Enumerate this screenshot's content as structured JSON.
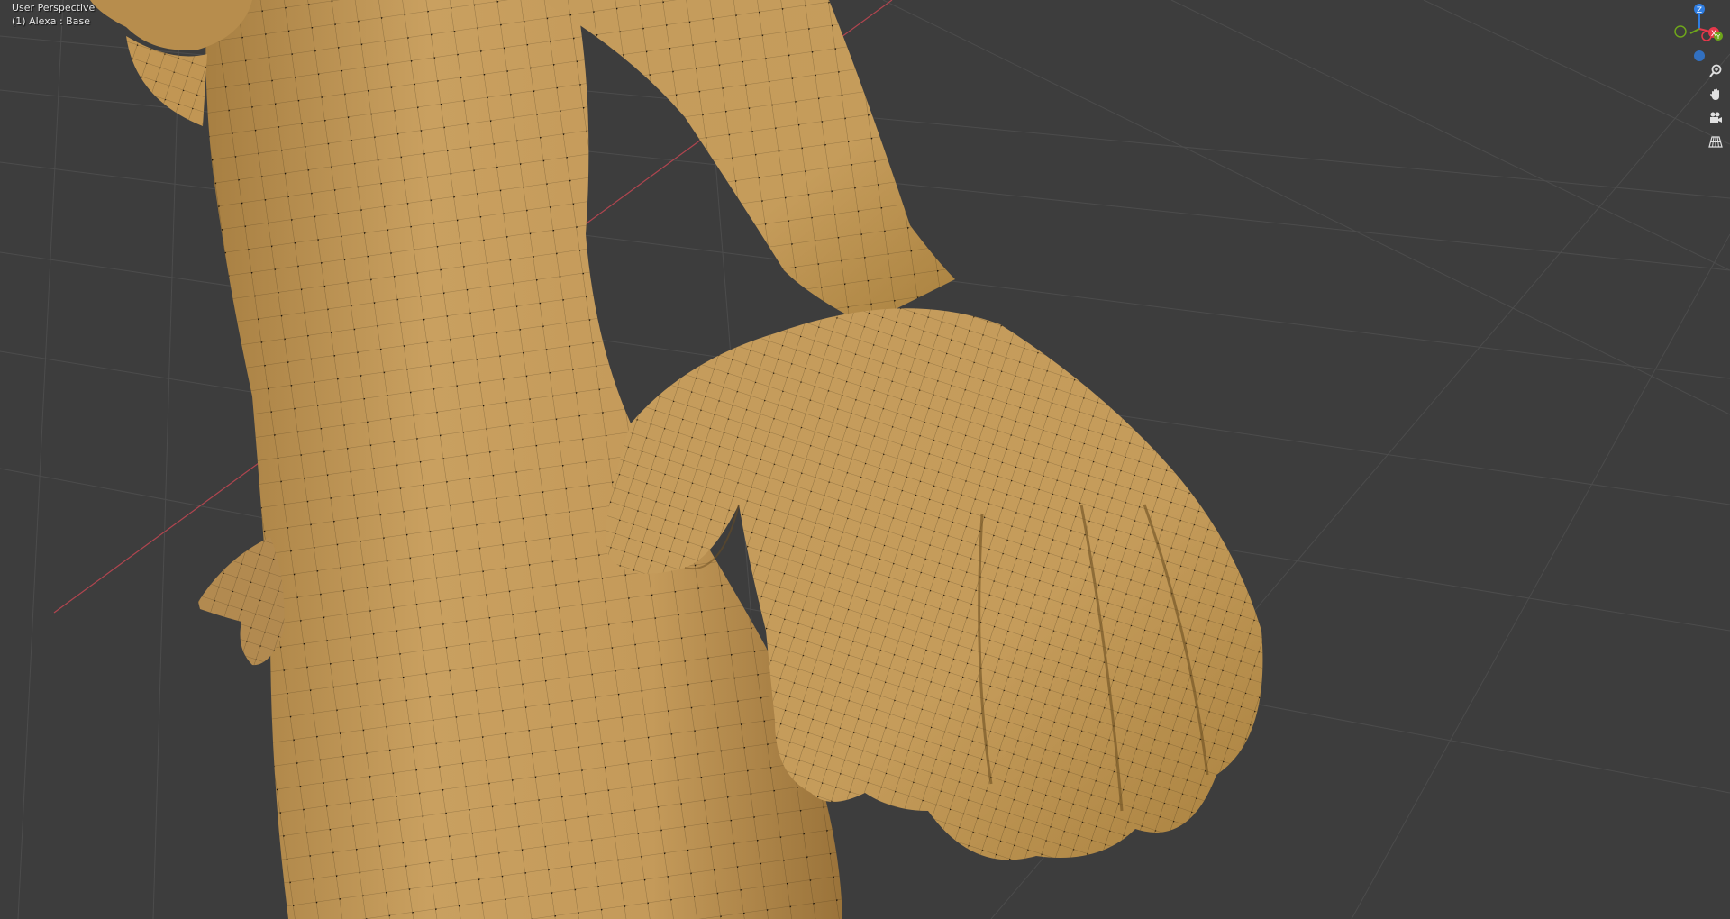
{
  "viewport": {
    "view_mode": "User Perspective",
    "object_info": "(1) Alexa : Base"
  },
  "gizmo": {
    "axes": [
      {
        "name": "Z",
        "color": "#2f7de1"
      },
      {
        "name": "X",
        "color": "#e6384b"
      },
      {
        "name": "Y",
        "color": "#6ea51b"
      }
    ]
  },
  "nav_tools": [
    {
      "name": "zoom",
      "icon": "zoom-icon"
    },
    {
      "name": "pan",
      "icon": "hand-icon"
    },
    {
      "name": "camera",
      "icon": "camera-icon"
    },
    {
      "name": "perspective",
      "icon": "grid-icon"
    }
  ],
  "colors": {
    "background": "#3d3d3d",
    "mesh": "#c9a060",
    "mesh_dark": "#8e6a34",
    "grid_line": "#4e4e4e",
    "x_axis_line": "#b0454f"
  }
}
